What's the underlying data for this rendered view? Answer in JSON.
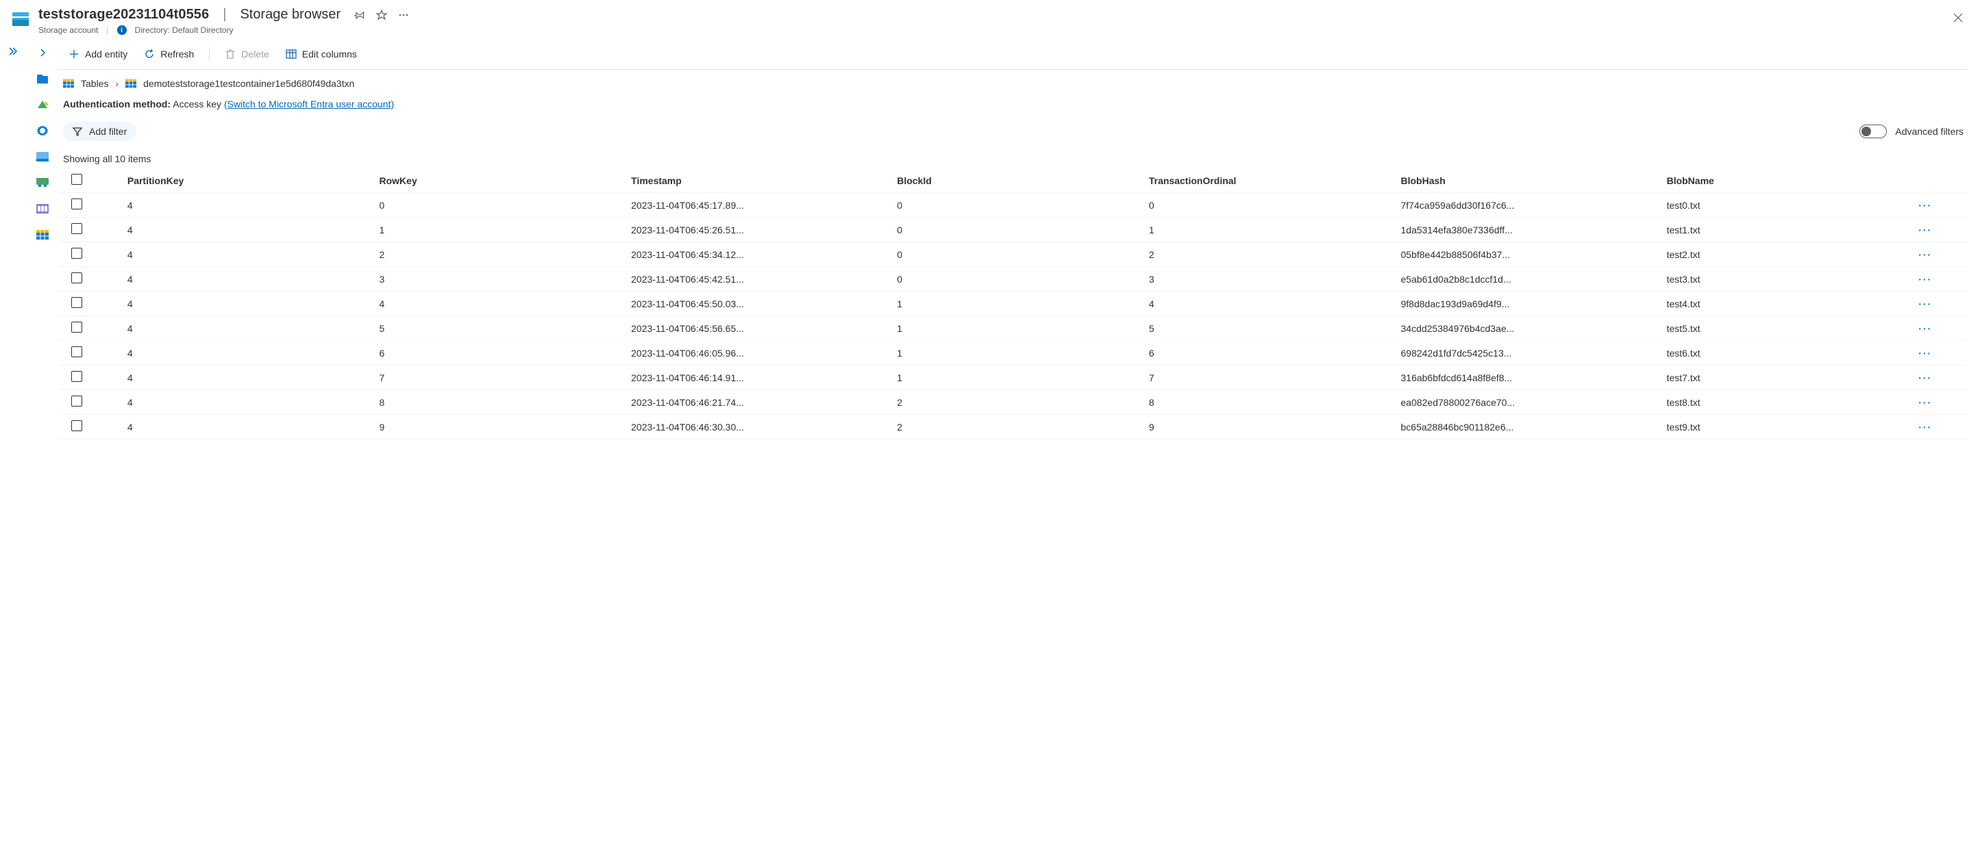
{
  "header": {
    "resource_name": "teststorage20231104t0556",
    "page_name": "Storage browser",
    "resource_type": "Storage account",
    "directory_label": "Directory: Default Directory"
  },
  "toolbar": {
    "add_entity": "Add entity",
    "refresh": "Refresh",
    "delete": "Delete",
    "edit_columns": "Edit columns"
  },
  "breadcrumb": {
    "root": "Tables",
    "current": "demoteststorage1testcontainer1e5d680f49da3txn"
  },
  "auth": {
    "label": "Authentication method:",
    "method": "Access key",
    "switch_link": "(Switch to Microsoft Entra user account)"
  },
  "filters": {
    "add_filter": "Add filter",
    "advanced": "Advanced filters"
  },
  "count_text": "Showing all 10 items",
  "columns": [
    "PartitionKey",
    "RowKey",
    "Timestamp",
    "BlockId",
    "TransactionOrdinal",
    "BlobHash",
    "BlobName"
  ],
  "rows": [
    {
      "PartitionKey": "4",
      "RowKey": "0",
      "Timestamp": "2023-11-04T06:45:17.89...",
      "BlockId": "0",
      "TransactionOrdinal": "0",
      "BlobHash": "7f74ca959a6dd30f167c6...",
      "BlobName": "test0.txt"
    },
    {
      "PartitionKey": "4",
      "RowKey": "1",
      "Timestamp": "2023-11-04T06:45:26.51...",
      "BlockId": "0",
      "TransactionOrdinal": "1",
      "BlobHash": "1da5314efa380e7336dff...",
      "BlobName": "test1.txt"
    },
    {
      "PartitionKey": "4",
      "RowKey": "2",
      "Timestamp": "2023-11-04T06:45:34.12...",
      "BlockId": "0",
      "TransactionOrdinal": "2",
      "BlobHash": "05bf8e442b88506f4b37...",
      "BlobName": "test2.txt"
    },
    {
      "PartitionKey": "4",
      "RowKey": "3",
      "Timestamp": "2023-11-04T06:45:42.51...",
      "BlockId": "0",
      "TransactionOrdinal": "3",
      "BlobHash": "e5ab61d0a2b8c1dccf1d...",
      "BlobName": "test3.txt"
    },
    {
      "PartitionKey": "4",
      "RowKey": "4",
      "Timestamp": "2023-11-04T06:45:50.03...",
      "BlockId": "1",
      "TransactionOrdinal": "4",
      "BlobHash": "9f8d8dac193d9a69d4f9...",
      "BlobName": "test4.txt"
    },
    {
      "PartitionKey": "4",
      "RowKey": "5",
      "Timestamp": "2023-11-04T06:45:56.65...",
      "BlockId": "1",
      "TransactionOrdinal": "5",
      "BlobHash": "34cdd25384976b4cd3ae...",
      "BlobName": "test5.txt"
    },
    {
      "PartitionKey": "4",
      "RowKey": "6",
      "Timestamp": "2023-11-04T06:46:05.96...",
      "BlockId": "1",
      "TransactionOrdinal": "6",
      "BlobHash": "698242d1fd7dc5425c13...",
      "BlobName": "test6.txt"
    },
    {
      "PartitionKey": "4",
      "RowKey": "7",
      "Timestamp": "2023-11-04T06:46:14.91...",
      "BlockId": "1",
      "TransactionOrdinal": "7",
      "BlobHash": "316ab6bfdcd614a8f8ef8...",
      "BlobName": "test7.txt"
    },
    {
      "PartitionKey": "4",
      "RowKey": "8",
      "Timestamp": "2023-11-04T06:46:21.74...",
      "BlockId": "2",
      "TransactionOrdinal": "8",
      "BlobHash": "ea082ed78800276ace70...",
      "BlobName": "test8.txt"
    },
    {
      "PartitionKey": "4",
      "RowKey": "9",
      "Timestamp": "2023-11-04T06:46:30.30...",
      "BlockId": "2",
      "TransactionOrdinal": "9",
      "BlobHash": "bc65a28846bc901182e6...",
      "BlobName": "test9.txt"
    }
  ]
}
